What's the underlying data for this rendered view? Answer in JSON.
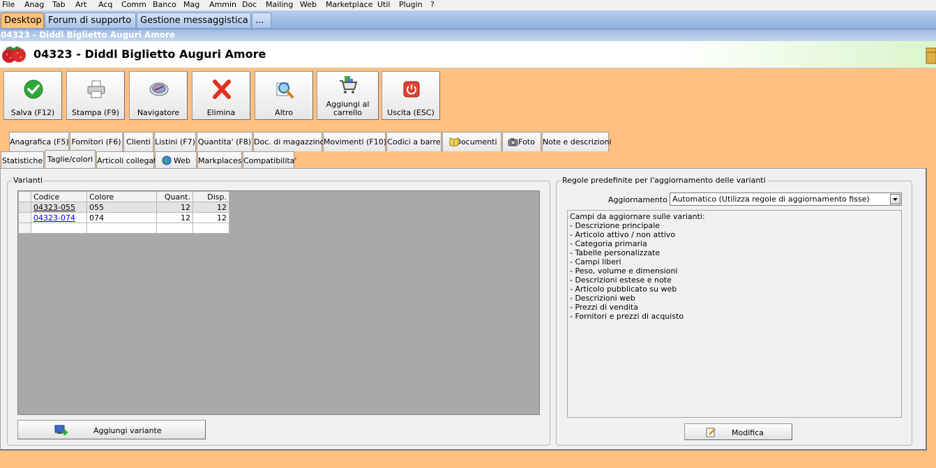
{
  "menu": [
    "File",
    "Anag",
    "Tab",
    "Art",
    "Acq",
    "Comm",
    "Banco",
    "Mag",
    "Ammin",
    "Doc",
    "Mailing",
    "Web",
    "Marketplace",
    "Util",
    "Plugin",
    "?"
  ],
  "window_tabs": [
    "Desktop",
    "Forum di supporto",
    "Gestione messaggistica",
    "..."
  ],
  "window_title": "04323 - Diddl Biglietto Auguri Amore",
  "header_title": "04323 - Diddl Biglietto Auguri Amore",
  "toolbar": {
    "save": "Salva (F12)",
    "print": "Stampa (F9)",
    "navigator": "Navigatore",
    "delete": "Elimina",
    "other": "Altro",
    "cart_line1": "Aggiungi al",
    "cart_line2": "carrello",
    "exit": "Uscita (ESC)"
  },
  "tabs_row1": [
    "Anagrafica (F5)",
    "Fornitori (F6)",
    "Clienti",
    "Listini (F7)",
    "Quantita' (F8)",
    "Doc. di magazzino",
    "Movimenti (F10)",
    "Codici a barre",
    "Documenti",
    "Foto",
    "Note e descrizioni"
  ],
  "tabs_row2": [
    "Statistiche",
    "Taglie/colori",
    "Articoli collegati",
    "Web",
    "Markplaces",
    "Compatibilita'"
  ],
  "varianti": {
    "title": "Varianti",
    "columns": [
      "Codice",
      "Colore",
      "Quant.",
      "Disp."
    ],
    "rows": [
      {
        "code": "04323-055",
        "color": "055",
        "qty": "12",
        "disp": "12"
      },
      {
        "code": "04323-074",
        "color": "074",
        "qty": "12",
        "disp": "12"
      }
    ],
    "add_button": "Aggiungi variante"
  },
  "rules": {
    "title": "Regole predefinite per l'aggiornamento delle varianti",
    "update_label": "Aggiornamento :",
    "update_value": "Automatico (Utilizza regole di aggiornamento fisse)",
    "fields_header": "Campi da aggiornare sulle varianti:",
    "fields": [
      "- Descrizione principale",
      "- Articolo attivo / non attivo",
      "- Categoria primaria",
      "- Tabelle personalizzate",
      "- Campi liberi",
      "- Peso, volume e dimensioni",
      "- Descrizioni estese e note",
      "- Articolo pubblicato su web",
      "- Descrizioni web",
      "- Prezzi di vendita",
      "- Fornitori e prezzi di acquisto"
    ],
    "edit_button": "Modifica"
  },
  "colors": {
    "accent": "#ffc082",
    "tab_blue": "#9bb8e3"
  }
}
